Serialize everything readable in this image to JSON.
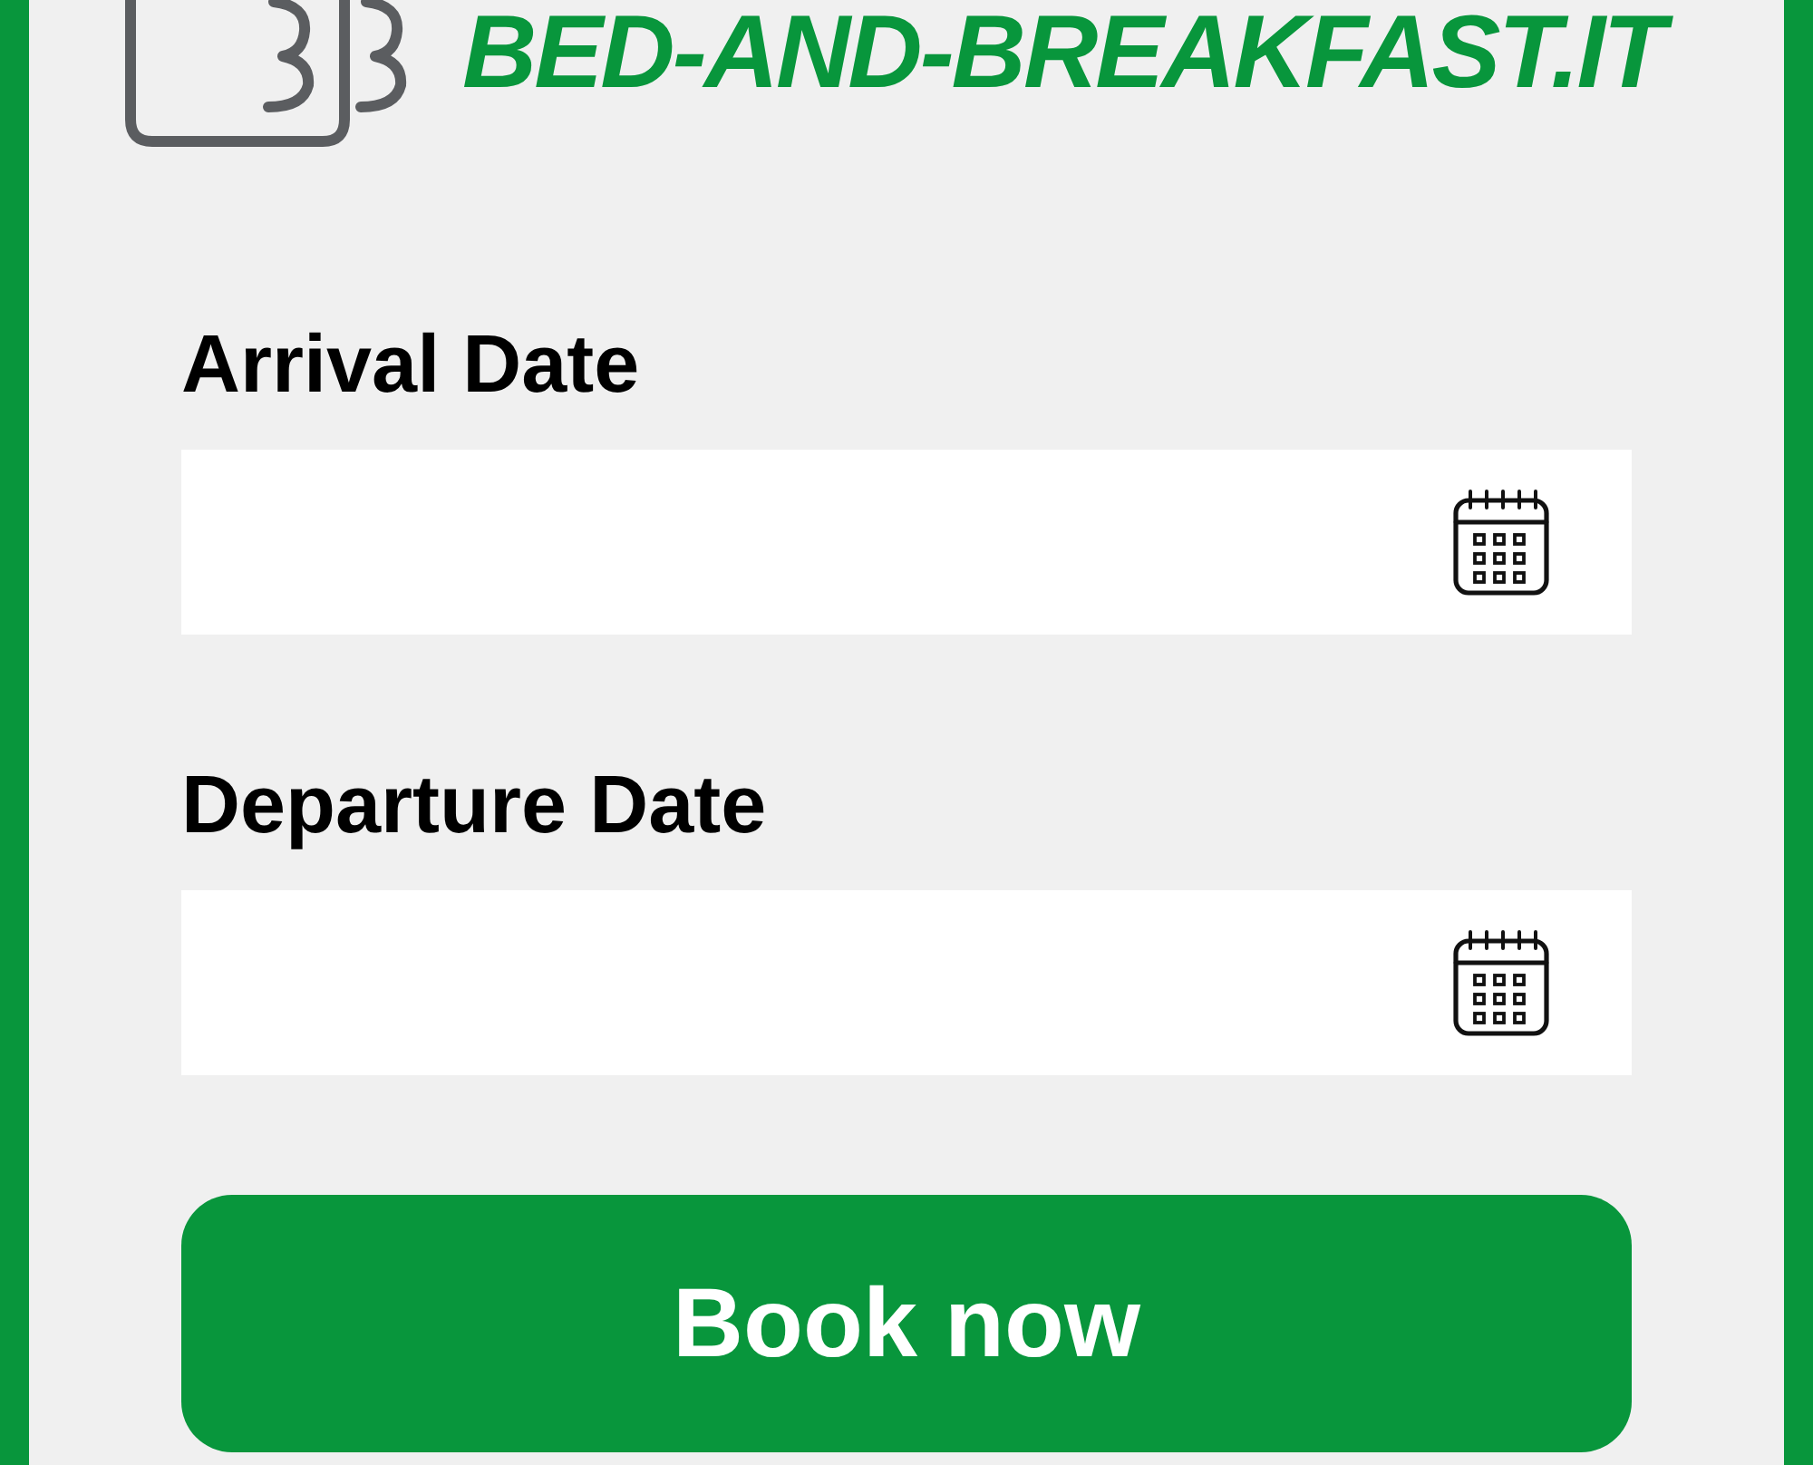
{
  "logo": {
    "text": "BED-AND-BREAKFAST.IT"
  },
  "form": {
    "fields": [
      {
        "label": "Arrival Date"
      },
      {
        "label": "Departure Date"
      }
    ],
    "submit": {
      "label": "Book now"
    }
  }
}
